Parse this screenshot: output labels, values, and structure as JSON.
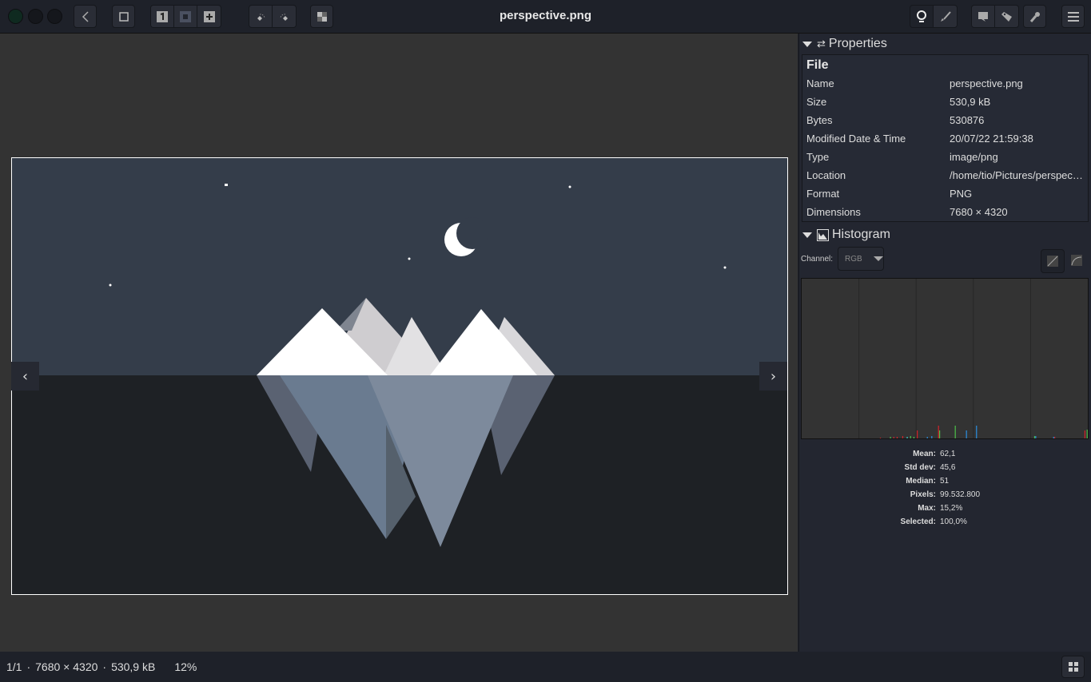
{
  "window": {
    "title": "perspective.png"
  },
  "toolbar": {
    "icons": [
      "back-icon",
      "fit-icon",
      "zoom-original-icon",
      "zoom-fit-icon",
      "zoom-in-icon",
      "rotate-left-icon",
      "rotate-right-icon",
      "checkerboard-icon",
      "info-icon",
      "brush-icon",
      "comment-icon",
      "tag-icon",
      "wrench-icon",
      "menu-icon"
    ]
  },
  "properties": {
    "header": "Properties",
    "section": "File",
    "rows": [
      {
        "k": "Name",
        "v": "perspective.png"
      },
      {
        "k": "Size",
        "v": "530,9 kB"
      },
      {
        "k": "Bytes",
        "v": "530876"
      },
      {
        "k": "Modified Date & Time",
        "v": "20/07/22 21:59:38"
      },
      {
        "k": "Type",
        "v": "image/png"
      },
      {
        "k": "Location",
        "v": "/home/tio/Pictures/perspective.png"
      },
      {
        "k": "Format",
        "v": "PNG"
      },
      {
        "k": "Dimensions",
        "v": "7680 × 4320"
      }
    ]
  },
  "histogram": {
    "header": "Histogram",
    "channel_label": "Channel:",
    "channel": "RGB",
    "colors": {
      "red": "#d2232a",
      "green": "#4cc04a",
      "blue": "#2a8ee0",
      "cyan": "#3ad0d0"
    },
    "bars": [
      {
        "bin": 70,
        "pct": 0.5,
        "c": "red"
      },
      {
        "bin": 79,
        "pct": 1,
        "c": "green"
      },
      {
        "bin": 82,
        "pct": 1,
        "c": "red"
      },
      {
        "bin": 85,
        "pct": 1,
        "c": "red"
      },
      {
        "bin": 90,
        "pct": 1.5,
        "c": "red"
      },
      {
        "bin": 94,
        "pct": 1,
        "c": "cyan"
      },
      {
        "bin": 97,
        "pct": 1.5,
        "c": "green"
      },
      {
        "bin": 100,
        "pct": 1,
        "c": "green"
      },
      {
        "bin": 103,
        "pct": 5,
        "c": "red"
      },
      {
        "bin": 112,
        "pct": 1,
        "c": "blue"
      },
      {
        "bin": 116,
        "pct": 1.5,
        "c": "blue"
      },
      {
        "bin": 122,
        "pct": 8,
        "c": "red"
      },
      {
        "bin": 123,
        "pct": 5,
        "c": "green"
      },
      {
        "bin": 137,
        "pct": 8,
        "c": "green"
      },
      {
        "bin": 147,
        "pct": 5,
        "c": "blue"
      },
      {
        "bin": 156,
        "pct": 8,
        "c": "blue"
      },
      {
        "bin": 208,
        "pct": 1.5,
        "c": "green"
      },
      {
        "bin": 209,
        "pct": 1.5,
        "c": "blue"
      },
      {
        "bin": 225,
        "pct": 1,
        "c": "blue"
      },
      {
        "bin": 226,
        "pct": 1,
        "c": "red"
      },
      {
        "bin": 253,
        "pct": 5,
        "c": "red"
      },
      {
        "bin": 255,
        "pct": 5.5,
        "c": "green"
      }
    ],
    "stats": [
      {
        "k": "Mean:",
        "v": "62,1"
      },
      {
        "k": "Std dev:",
        "v": "45,6"
      },
      {
        "k": "Median:",
        "v": "51"
      },
      {
        "k": "Pixels:",
        "v": "99.532.800"
      },
      {
        "k": "Max:",
        "v": "15,2%"
      },
      {
        "k": "Selected:",
        "v": "100,0%"
      }
    ]
  },
  "status": {
    "index": "1/1",
    "dimensions": "7680 × 4320",
    "size": "530,9 kB",
    "zoom": "12%",
    "sep": "·"
  }
}
